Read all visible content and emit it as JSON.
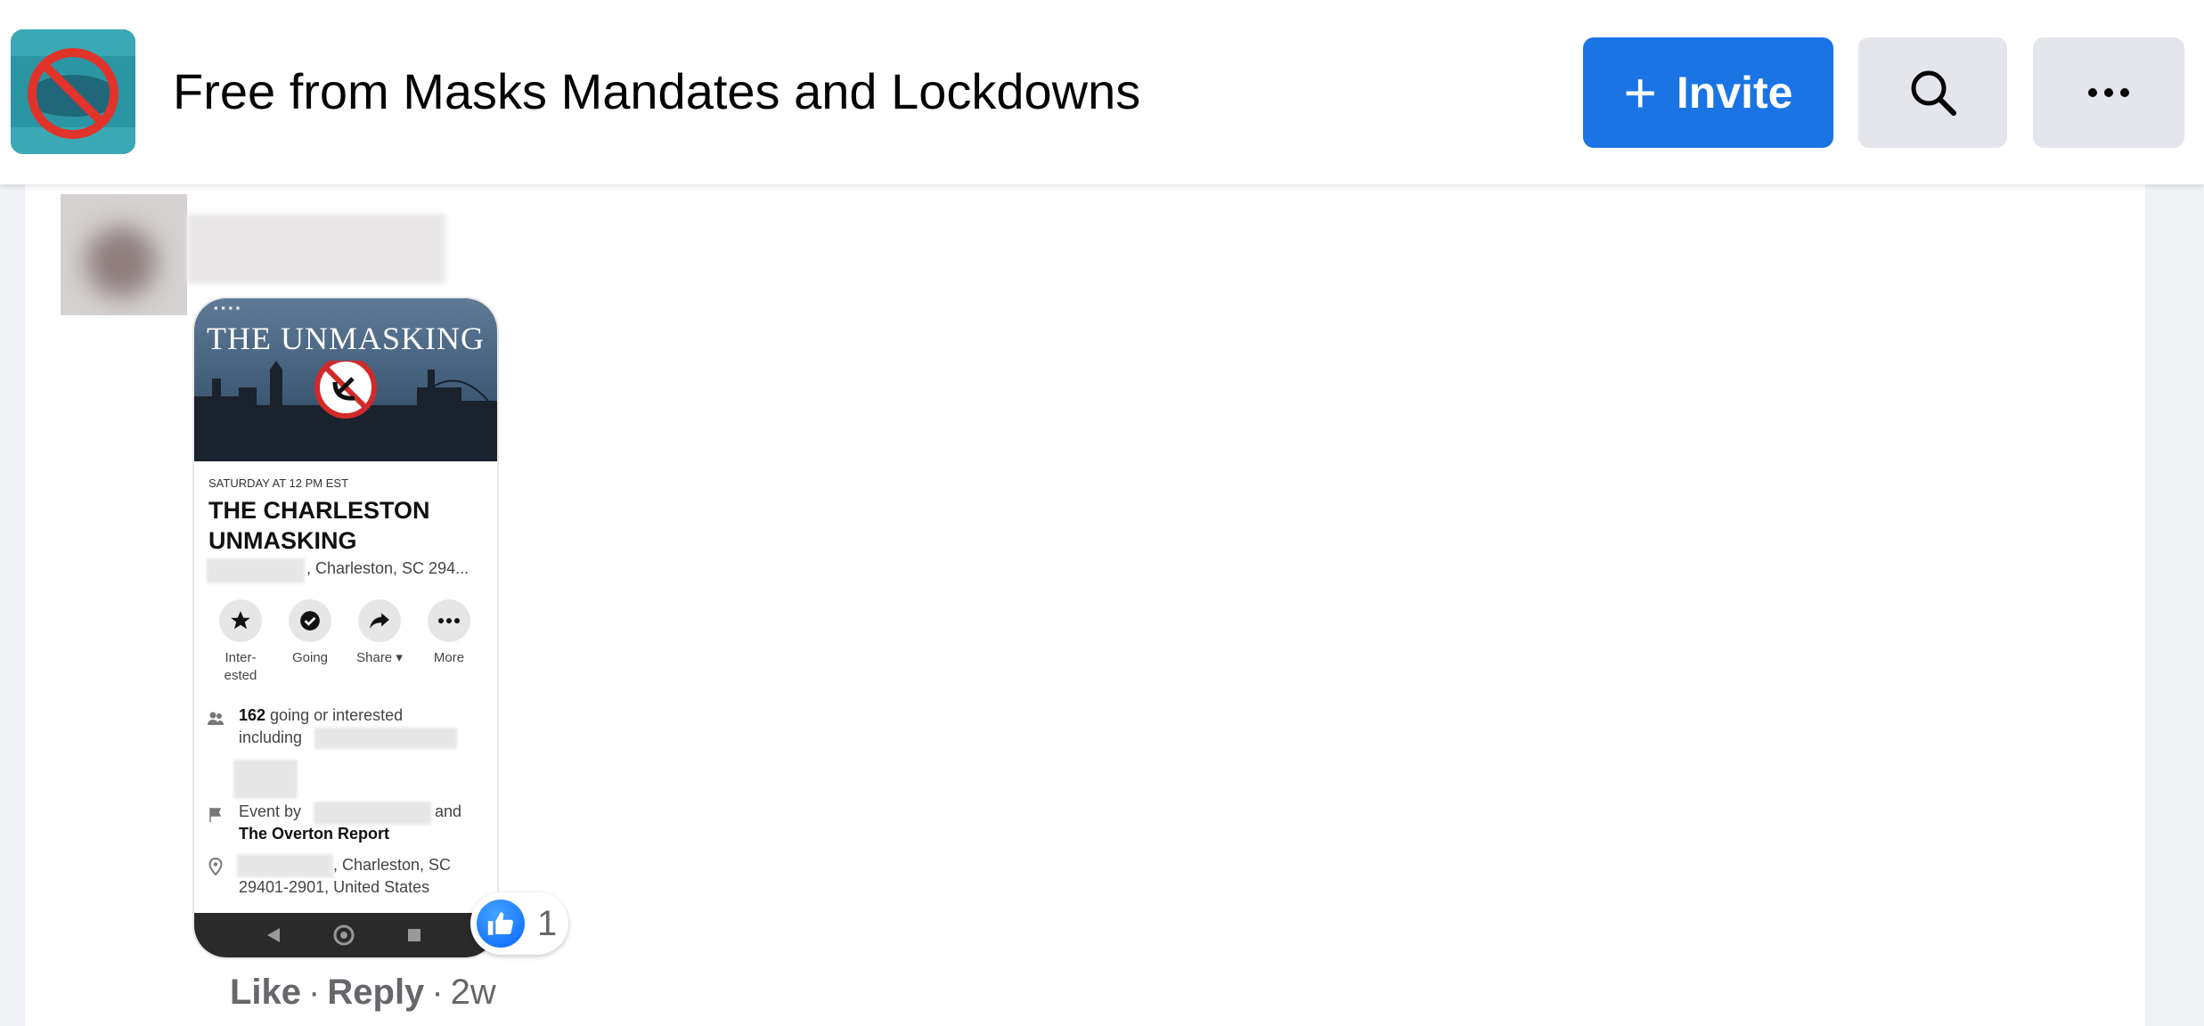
{
  "group": {
    "name": "Free from Masks Mandates and Lockdowns",
    "avatar_icon": "group-cover-icon"
  },
  "header": {
    "invite_label": "Invite",
    "invite_icon": "plus-icon",
    "search_icon": "search-icon",
    "more_icon": "more-icon"
  },
  "colors": {
    "primary": "#1b74e4",
    "secondary_button": "#e4e6eb",
    "page_background": "#f0f2f5",
    "muted_text": "#65676b"
  },
  "comment": {
    "attachment": {
      "banner_title": "THE UNMASKING",
      "when": "SATURDAY AT 12 PM EST",
      "event_title": "THE CHARLESTON UNMASKING",
      "location_short": ", Charleston, SC 294...",
      "actions": [
        {
          "label": "Inter-\nested",
          "icon": "star-icon"
        },
        {
          "label": "Going",
          "icon": "check-circle-icon"
        },
        {
          "label": "Share ▾",
          "icon": "share-icon"
        },
        {
          "label": "More",
          "icon": "more-icon"
        }
      ],
      "going_count": "162",
      "going_text": " going or interested",
      "including_text": "including",
      "event_by_prefix": "Event by",
      "event_by_suffix": "and",
      "organizer": "The Overton Report",
      "address_line1": ", Charleston, SC",
      "address_line2": "29401-2901, United States"
    },
    "reaction": {
      "icon": "like-icon",
      "count": "1"
    },
    "actions": {
      "like": "Like",
      "reply": "Reply",
      "separator": "·",
      "time": "2w"
    }
  }
}
